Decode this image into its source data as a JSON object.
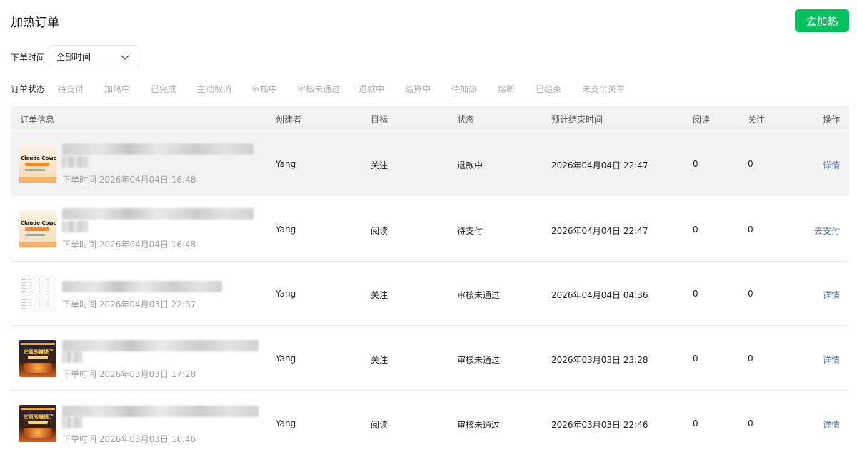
{
  "header": {
    "title": "加热订单",
    "primary_button": "去加热"
  },
  "filter": {
    "time_label": "下单时间",
    "time_value": "全部时间"
  },
  "status": {
    "label": "订单状态",
    "tabs": [
      "待支付",
      "加热中",
      "已完成",
      "主动取消",
      "审核中",
      "审核未通过",
      "退款中",
      "结算中",
      "待加热",
      "熔断",
      "已结束",
      "未支付关单"
    ]
  },
  "table": {
    "columns": [
      "订单信息",
      "创建者",
      "目标",
      "状态",
      "预计结束时间",
      "阅读",
      "关注",
      "操作"
    ],
    "rows": [
      {
        "order_time": "下单时间 2026年04月04日 16:48",
        "creator": "Yang",
        "target": "关注",
        "status": "退款中",
        "end_time": "2026年04月04日 22:47",
        "reads": "0",
        "follows": "0",
        "action": "详情",
        "thumb": "claude-cowork-thumbnail",
        "thumb_text": "Claude Cowork"
      },
      {
        "order_time": "下单时间 2026年04月04日 16:48",
        "creator": "Yang",
        "target": "阅读",
        "status": "待支付",
        "end_time": "2026年04月04日 22:47",
        "reads": "0",
        "follows": "0",
        "action": "去支付",
        "thumb": "claude-cowork-thumbnail",
        "thumb_text": "Claude Cowork"
      },
      {
        "order_time": "下单时间 2026年04月03日 22:37",
        "creator": "Yang",
        "target": "关注",
        "status": "审核未通过",
        "end_time": "2026年04月04日 04:36",
        "reads": "0",
        "follows": "0",
        "action": "详情",
        "thumb": "text-document-thumbnail",
        "thumb_text": ""
      },
      {
        "order_time": "下单时间 2026年03月03日 17:28",
        "creator": "Yang",
        "target": "关注",
        "status": "审核未通过",
        "end_time": "2026年03月03日 23:28",
        "reads": "0",
        "follows": "0",
        "action": "详情",
        "thumb": "dark-poster-thumbnail",
        "thumb_text": "它真的赚钱了"
      },
      {
        "order_time": "下单时间 2026年03月03日 16:46",
        "creator": "Yang",
        "target": "阅读",
        "status": "审核未通过",
        "end_time": "2026年03月03日 22:46",
        "reads": "0",
        "follows": "0",
        "action": "详情",
        "thumb": "dark-poster-thumbnail",
        "thumb_text": "它真的赚钱了"
      }
    ]
  },
  "colors": {
    "primary": "#07c160",
    "link": "#576b95",
    "muted": "#b0b0b0",
    "header_bg": "#f2f2f2"
  }
}
